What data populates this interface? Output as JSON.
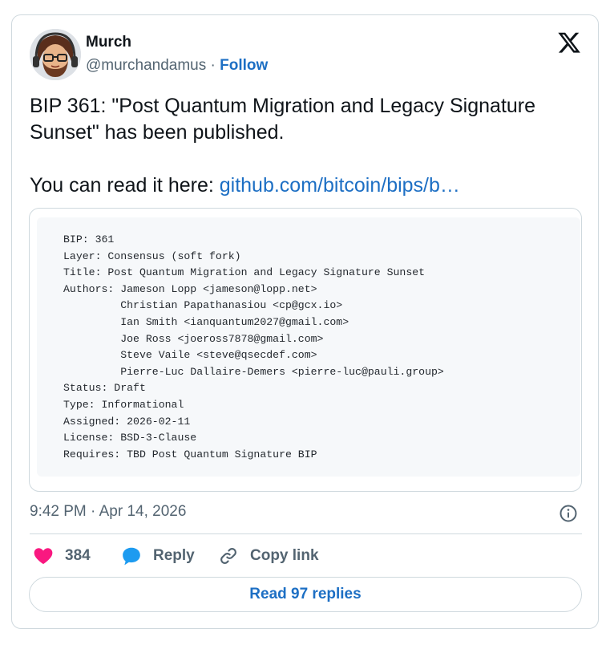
{
  "author": {
    "name": "Murch",
    "handle": "@murchandamus",
    "separator": " · ",
    "follow_label": "Follow"
  },
  "tweet": {
    "line1": "BIP 361: \"Post Quantum Migration and Legacy Signature Sunset\" has been published.",
    "line2_prefix": "You can read it here: ",
    "link_text": "github.com/bitcoin/bips/b…"
  },
  "media": {
    "code_lines": [
      "BIP: 361",
      "Layer: Consensus (soft fork)",
      "Title: Post Quantum Migration and Legacy Signature Sunset",
      "Authors: Jameson Lopp <jameson@lopp.net>",
      "         Christian Papathanasiou <cp@gcx.io>",
      "         Ian Smith <ianquantum2027@gmail.com>",
      "         Joe Ross <joeross7878@gmail.com>",
      "         Steve Vaile <steve@qsecdef.com>",
      "         Pierre-Luc Dallaire-Demers <pierre-luc@pauli.group>",
      "Status: Draft",
      "Type: Informational",
      "Assigned: 2026-02-11",
      "License: BSD-3-Clause",
      "Requires: TBD Post Quantum Signature BIP"
    ]
  },
  "timestamp": "9:42 PM · Apr 14, 2026",
  "actions": {
    "like_count": "384",
    "reply_label": "Reply",
    "copy_label": "Copy link"
  },
  "read_replies_label": "Read 97 replies",
  "colors": {
    "accent": "#1d6fc4",
    "like": "#f91880",
    "reply": "#1d9bf0",
    "muted": "#536471",
    "border": "#cfd9de"
  },
  "icons": {
    "logo": "x-logo-icon",
    "info": "info-icon",
    "like": "heart-icon",
    "reply": "speech-bubble-icon",
    "copy": "link-icon"
  }
}
